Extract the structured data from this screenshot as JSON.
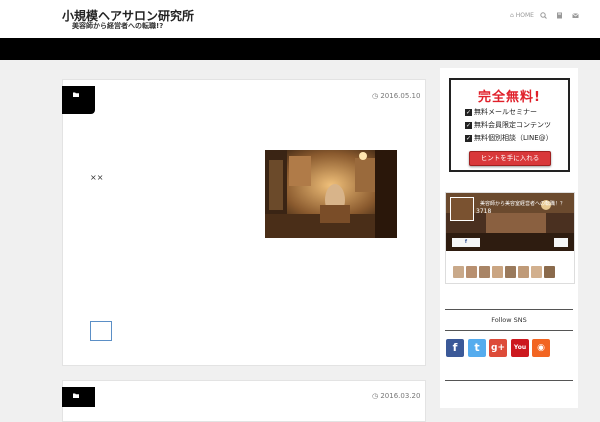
{
  "header": {
    "site_title": "小規模ヘアサロン研究所",
    "site_subtitle": "美容師から経営者への転職!?",
    "nav": {
      "home_label": "HOME",
      "home_icon": "home-icon",
      "icons": [
        "search-icon",
        "book-icon",
        "mail-icon"
      ]
    }
  },
  "posts": [
    {
      "date": "2016.05.10",
      "category_icon": "folder-icon",
      "excerpt": "××"
    },
    {
      "date": "2016.03.20",
      "category_icon": "folder-icon"
    }
  ],
  "sidebar": {
    "promo": {
      "title": "完全無料!",
      "items": [
        "無料メールセミナー",
        "無料会員限定コンテンツ",
        "無料個別相談（LINE@）"
      ],
      "button": "ヒントを手に入れる",
      "accent": "#e0202a"
    },
    "facebook": {
      "page_name": "美容師から美容室経営者への転職！？",
      "count": "3718"
    },
    "follow_label": "Follow SNS",
    "sns": [
      {
        "icon": "facebook-icon",
        "glyph": "f",
        "color": "#3b5998"
      },
      {
        "icon": "twitter-icon",
        "glyph": "t",
        "color": "#55acee"
      },
      {
        "icon": "googleplus-icon",
        "glyph": "g+",
        "color": "#dd4b39"
      },
      {
        "icon": "youtube-icon",
        "glyph": "You",
        "color": "#cc181e"
      },
      {
        "icon": "rss-icon",
        "glyph": "◉",
        "color": "#f26522"
      }
    ]
  }
}
